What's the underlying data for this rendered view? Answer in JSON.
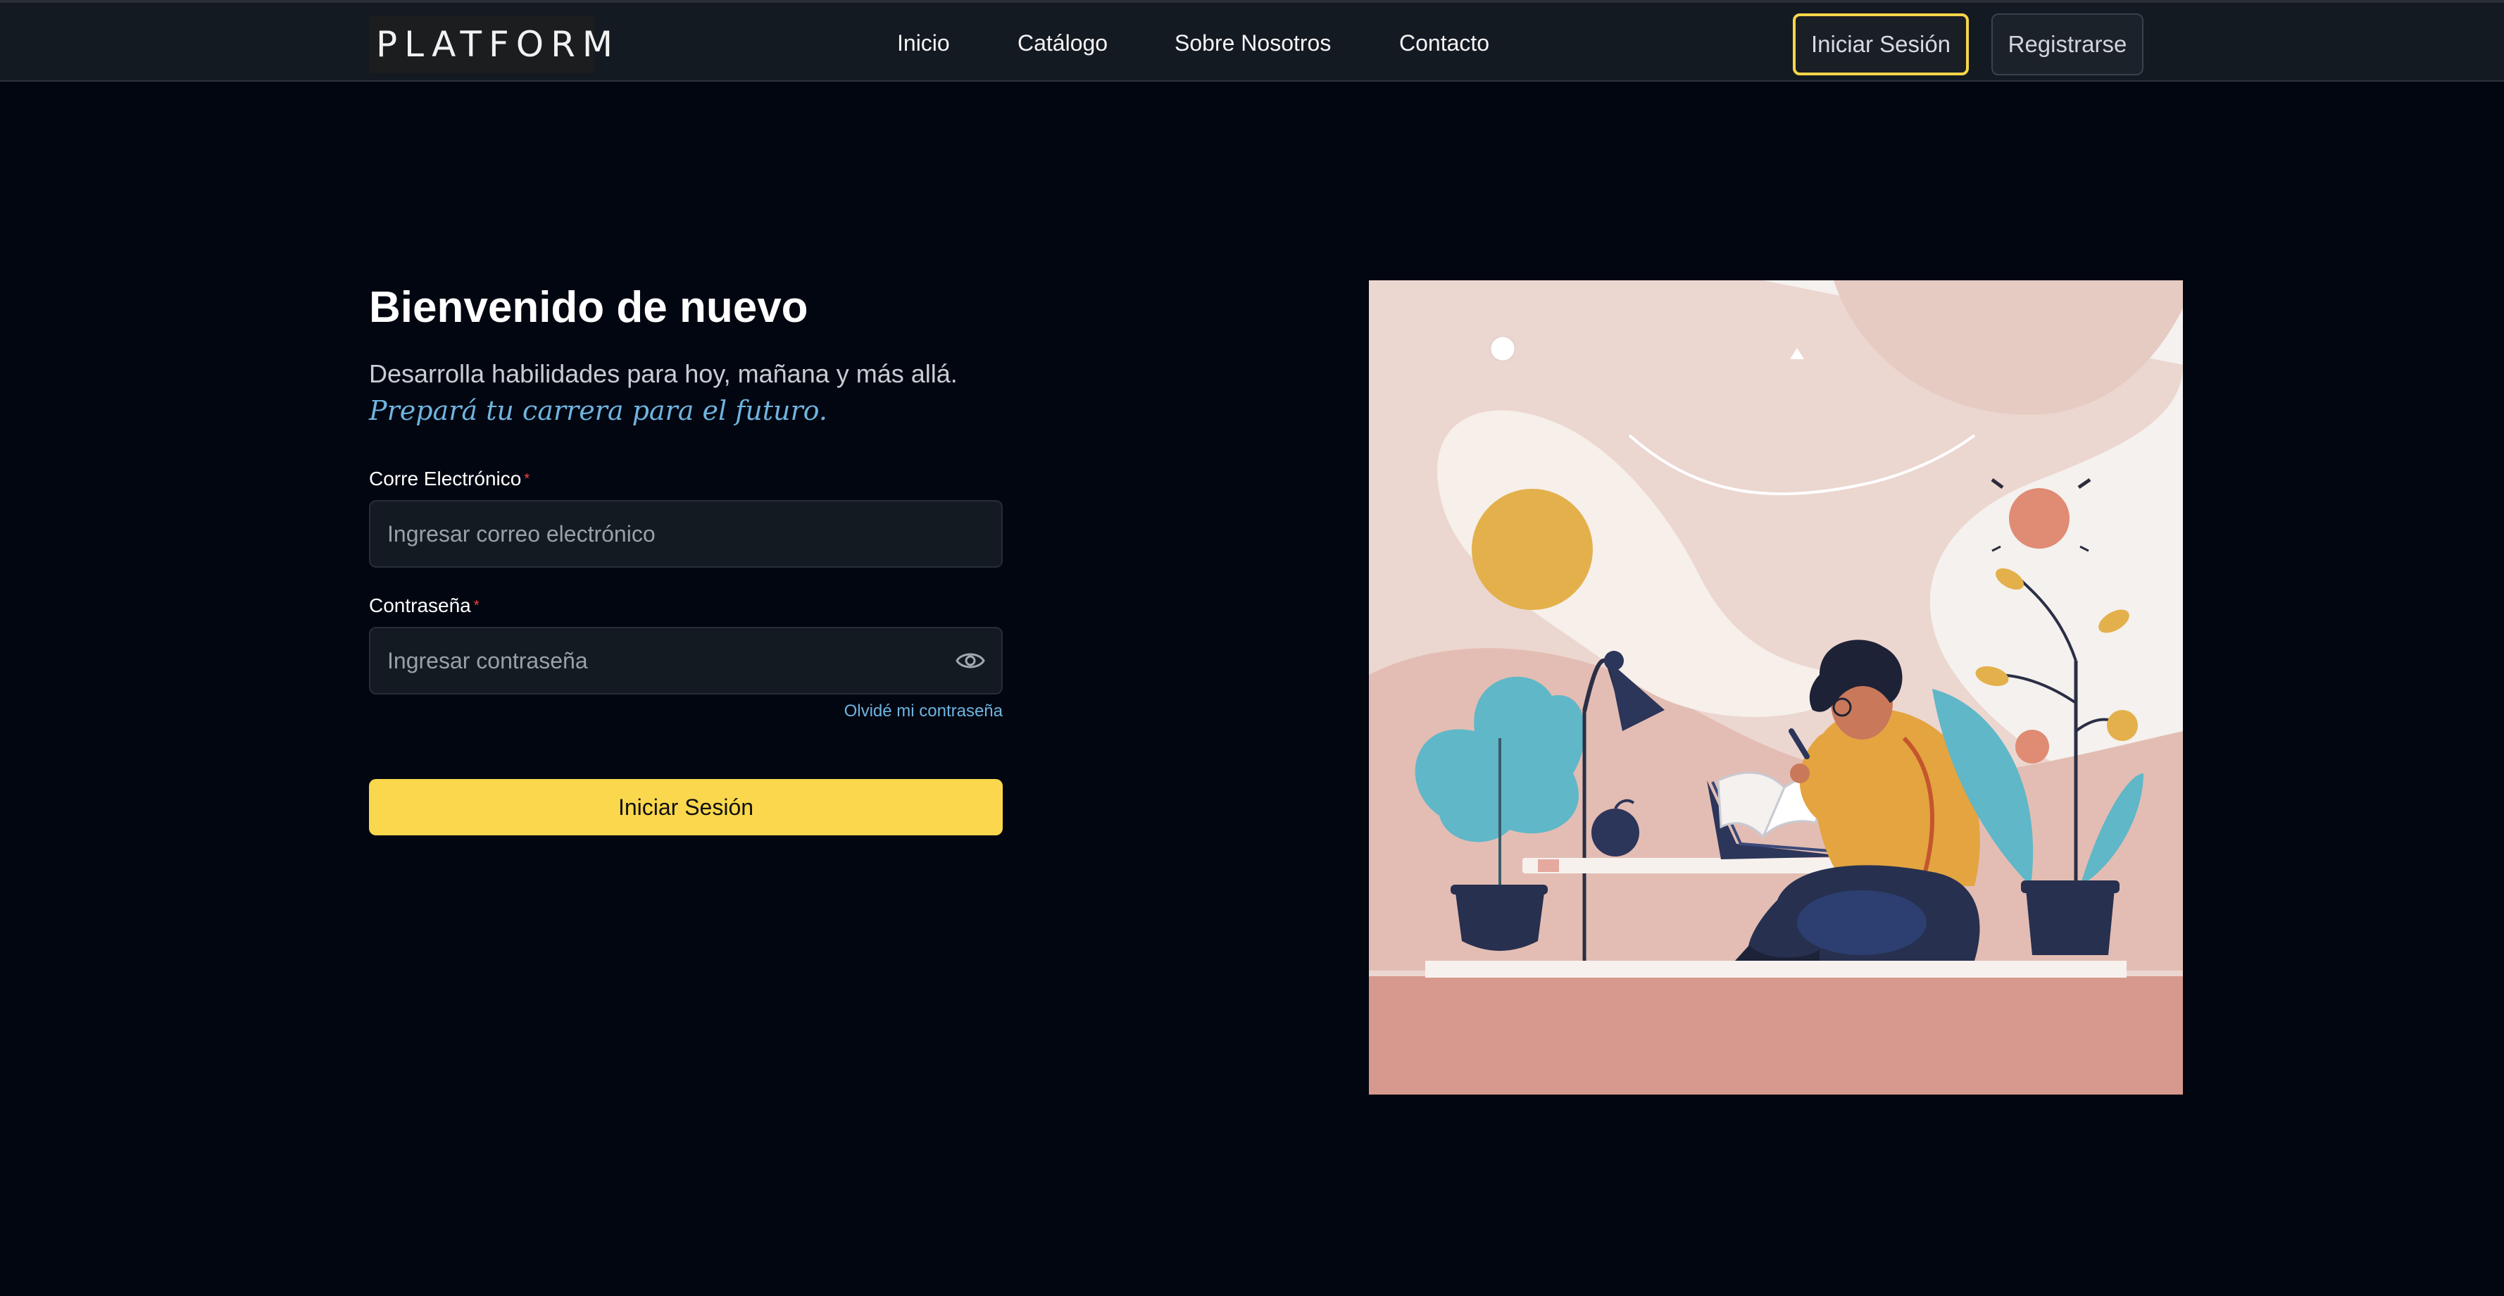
{
  "header": {
    "logo": "PLATFORM",
    "nav": [
      {
        "label": "Inicio"
      },
      {
        "label": "Catálogo"
      },
      {
        "label": "Sobre Nosotros"
      },
      {
        "label": "Contacto"
      }
    ],
    "login_label": "Iniciar Sesión",
    "register_label": "Registrarse"
  },
  "form": {
    "title": "Bienvenido de nuevo",
    "subtitle": "Desarrolla habilidades para hoy, mañana y más allá.",
    "tagline": "Prepará tu carrera para el futuro.",
    "email_label": "Corre Electrónico",
    "email_required": "*",
    "email_placeholder": "Ingresar correo electrónico",
    "password_label": "Contraseña",
    "password_required": "*",
    "password_placeholder": "Ingresar contraseña",
    "forgot_label": "Olvidé mi contraseña",
    "submit_label": "Iniciar Sesión"
  },
  "icons": {
    "password_toggle": "eye-icon"
  },
  "colors": {
    "accent": "#fad74c",
    "link": "#6fb4e0",
    "background": "#020610",
    "header": "#141a22"
  }
}
